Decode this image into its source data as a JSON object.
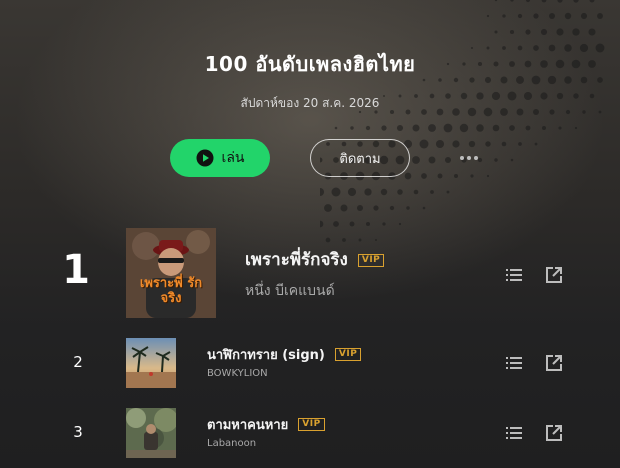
{
  "header": {
    "title": "100 อันดับเพลงฮิตไทย",
    "subtitle": "สัปดาห์ของ 20 ส.ค. 2026"
  },
  "actions": {
    "play_label": "เล่น",
    "follow_label": "ติดตาม"
  },
  "tracks": [
    {
      "rank": "1",
      "title": "เพราะพี่รักจริง",
      "badge": "VIP",
      "artist": "หนึ่ง บีเคแบนด์",
      "cover_text": "เพราะพี่ รักจริง"
    },
    {
      "rank": "2",
      "title": "นาฬิกาทราย (sign)",
      "badge": "VIP",
      "artist": "BOWKYLION"
    },
    {
      "rank": "3",
      "title": "ตามหาคนหาย",
      "badge": "VIP",
      "artist": "Labanoon"
    }
  ],
  "colors": {
    "accent_green": "#22d46a",
    "vip_gold": "#d9a12f",
    "background": "#1f1f20"
  },
  "icons": [
    "play-icon",
    "more-icon",
    "playlist-icon",
    "share-icon"
  ]
}
